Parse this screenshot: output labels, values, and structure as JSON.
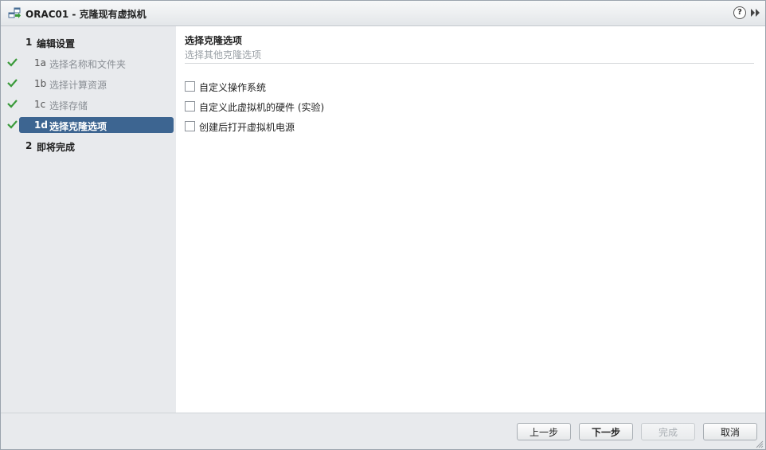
{
  "window": {
    "title": "ORAC01 - 克隆现有虚拟机",
    "help_glyph": "?"
  },
  "wizard": {
    "steps": [
      {
        "num": "1",
        "label": "编辑设置"
      },
      {
        "num": "1a",
        "label": "选择名称和文件夹"
      },
      {
        "num": "1b",
        "label": "选择计算资源"
      },
      {
        "num": "1c",
        "label": "选择存储"
      },
      {
        "num": "1d",
        "label": "选择克隆选项"
      },
      {
        "num": "2",
        "label": "即将完成"
      }
    ]
  },
  "content": {
    "title": "选择克隆选项",
    "subtitle": "选择其他克隆选项",
    "options": [
      {
        "label": "自定义操作系统"
      },
      {
        "label": "自定义此虚拟机的硬件 (实验)"
      },
      {
        "label": "创建后打开虚拟机电源"
      }
    ]
  },
  "footer": {
    "back_label": "上一步",
    "next_label": "下一步",
    "finish_label": "完成",
    "cancel_label": "取消"
  },
  "colors": {
    "accent": "#3d6591",
    "check": "#3a9a3a",
    "sidebar_bg": "#e8eaed"
  },
  "icons": {
    "title": "vm-clone-icon",
    "help": "help-icon",
    "expand": "double-chevron-right-icon",
    "step_done": "checkmark-icon"
  }
}
